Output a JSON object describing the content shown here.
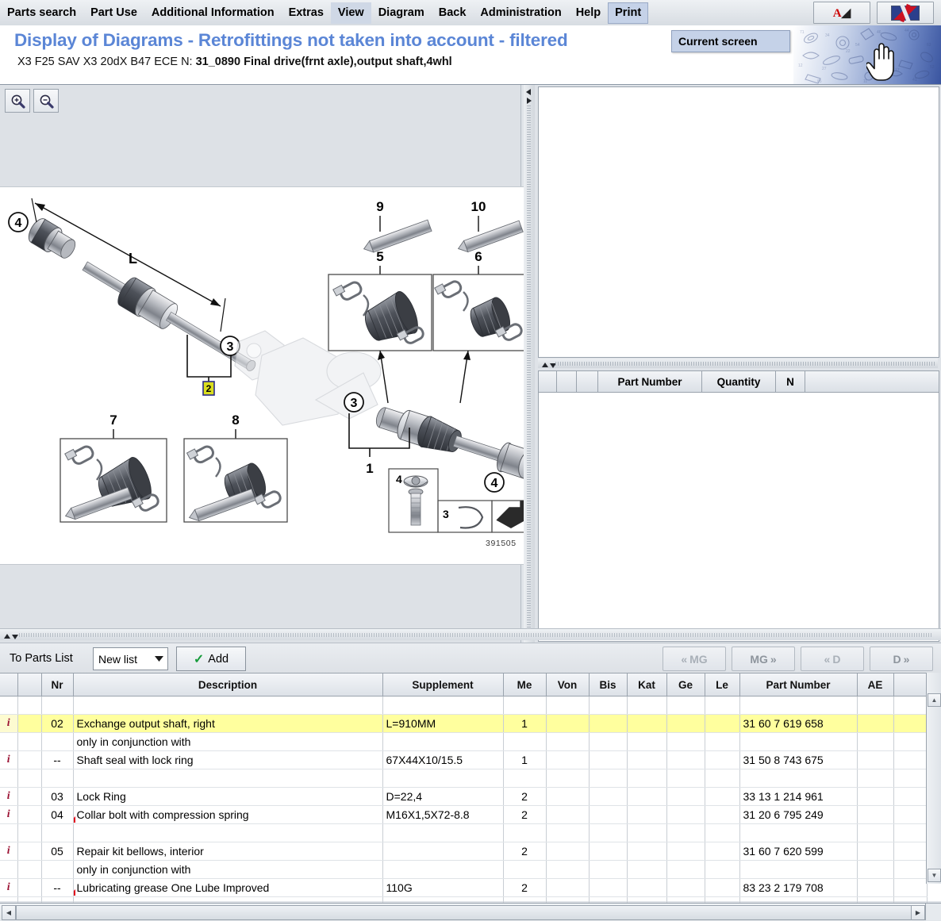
{
  "menu": {
    "items": [
      {
        "label": "Parts search",
        "state": "normal"
      },
      {
        "label": "Part Use",
        "state": "normal"
      },
      {
        "label": "Additional Information",
        "state": "normal"
      },
      {
        "label": "Extras",
        "state": "normal"
      },
      {
        "label": "View",
        "state": "highlight"
      },
      {
        "label": "Diagram",
        "state": "normal"
      },
      {
        "label": "Back",
        "state": "normal"
      },
      {
        "label": "Administration",
        "state": "normal"
      },
      {
        "label": "Help",
        "state": "normal"
      },
      {
        "label": "Print",
        "state": "selected"
      }
    ],
    "dropdown": {
      "parent": "Print",
      "items": [
        "Current screen"
      ],
      "selected": "Current screen"
    },
    "toolbar_buttons": [
      {
        "name": "aftersales-icon",
        "label": "A"
      },
      {
        "name": "language-flag-icon",
        "label": ""
      }
    ]
  },
  "header": {
    "title": "Display of Diagrams - Retrofittings not taken into account - filtered",
    "subtitle_prefix": "X3 F25 SAV X3 20dX B47 ECE  N: ",
    "subtitle_bold": "31_0890 Final drive(frnt axle),output shaft,4whl",
    "title_color": "#5b86d6"
  },
  "diagram": {
    "zoom_in_label": "zoom-in",
    "zoom_out_label": "zoom-out",
    "image_number": "391505",
    "callouts": [
      "1",
      "2",
      "3",
      "4",
      "5",
      "6",
      "7",
      "8",
      "9",
      "10",
      "L"
    ]
  },
  "right_panel": {
    "columns": [
      "",
      "",
      "",
      "Part Number",
      "Quantity",
      "N"
    ],
    "rows": []
  },
  "toolbar": {
    "to_parts_list_label": "To Parts List",
    "list_select_value": "New list",
    "add_label": "Add",
    "nav_buttons": [
      {
        "label": "MG",
        "prefix": "«",
        "suffix": "",
        "name": "mg-prev-button"
      },
      {
        "label": "MG",
        "prefix": "",
        "suffix": "»",
        "name": "mg-next-button"
      },
      {
        "label": "D",
        "prefix": "«",
        "suffix": "",
        "name": "d-prev-button"
      },
      {
        "label": "D",
        "prefix": "",
        "suffix": "»",
        "name": "d-next-button"
      }
    ]
  },
  "parts_table": {
    "columns": [
      "",
      "",
      "Nr",
      "Description",
      "Supplement",
      "Me",
      "Von",
      "Bis",
      "Kat",
      "Ge",
      "Le",
      "Part Number",
      "AE",
      ""
    ],
    "rows": [
      {
        "info": "",
        "nr": "",
        "description": "",
        "supplement": "",
        "me": "",
        "von": "",
        "bis": "",
        "kat": "",
        "ge": "",
        "le": "",
        "part_number": "",
        "ae": "",
        "highlight": false,
        "marker": false
      },
      {
        "info": "i",
        "nr": "02",
        "description": "Exchange output shaft, right",
        "supplement": "L=910MM",
        "me": "1",
        "von": "",
        "bis": "",
        "kat": "",
        "ge": "",
        "le": "",
        "part_number": "31 60 7 619 658",
        "ae": "",
        "highlight": true,
        "marker": false
      },
      {
        "info": "",
        "nr": "",
        "description": "only in conjunction with",
        "supplement": "",
        "me": "",
        "von": "",
        "bis": "",
        "kat": "",
        "ge": "",
        "le": "",
        "part_number": "",
        "ae": "",
        "highlight": false,
        "marker": false
      },
      {
        "info": "i",
        "nr": "--",
        "description": "Shaft seal with lock ring",
        "supplement": "67X44X10/15.5",
        "me": "1",
        "von": "",
        "bis": "",
        "kat": "",
        "ge": "",
        "le": "",
        "part_number": "31 50 8 743 675",
        "ae": "",
        "highlight": false,
        "marker": false
      },
      {
        "info": "",
        "nr": "",
        "description": "",
        "supplement": "",
        "me": "",
        "von": "",
        "bis": "",
        "kat": "",
        "ge": "",
        "le": "",
        "part_number": "",
        "ae": "",
        "highlight": false,
        "marker": false
      },
      {
        "info": "i",
        "nr": "03",
        "description": "Lock Ring",
        "supplement": "D=22,4",
        "me": "2",
        "von": "",
        "bis": "",
        "kat": "",
        "ge": "",
        "le": "",
        "part_number": "33 13 1 214 961",
        "ae": "",
        "highlight": false,
        "marker": false
      },
      {
        "info": "i",
        "nr": "04",
        "description": "Collar bolt with compression spring",
        "supplement": "M16X1,5X72-8.8",
        "me": "2",
        "von": "",
        "bis": "",
        "kat": "",
        "ge": "",
        "le": "",
        "part_number": "31 20 6 795 249",
        "ae": "",
        "highlight": false,
        "marker": true
      },
      {
        "info": "",
        "nr": "",
        "description": "",
        "supplement": "",
        "me": "",
        "von": "",
        "bis": "",
        "kat": "",
        "ge": "",
        "le": "",
        "part_number": "",
        "ae": "",
        "highlight": false,
        "marker": false
      },
      {
        "info": "i",
        "nr": "05",
        "description": "Repair kit bellows, interior",
        "supplement": "",
        "me": "2",
        "von": "",
        "bis": "",
        "kat": "",
        "ge": "",
        "le": "",
        "part_number": "31 60 7 620 599",
        "ae": "",
        "highlight": false,
        "marker": false
      },
      {
        "info": "",
        "nr": "",
        "description": "only in conjunction with",
        "supplement": "",
        "me": "",
        "von": "",
        "bis": "",
        "kat": "",
        "ge": "",
        "le": "",
        "part_number": "",
        "ae": "",
        "highlight": false,
        "marker": false
      },
      {
        "info": "i",
        "nr": "--",
        "description": "Lubricating grease One Lube Improved",
        "supplement": "110G",
        "me": "2",
        "von": "",
        "bis": "",
        "kat": "",
        "ge": "",
        "le": "",
        "part_number": "83 23 2 179 708",
        "ae": "",
        "highlight": false,
        "marker": true
      },
      {
        "info": "",
        "nr": "",
        "description": "",
        "supplement": "",
        "me": "",
        "von": "",
        "bis": "",
        "kat": "",
        "ge": "",
        "le": "",
        "part_number": "",
        "ae": "",
        "highlight": false,
        "marker": false
      }
    ]
  },
  "colors": {
    "highlight_row": "#ffff9e",
    "title": "#5b86d6",
    "info_icon": "#9b1233",
    "marker": "#e2041b"
  }
}
